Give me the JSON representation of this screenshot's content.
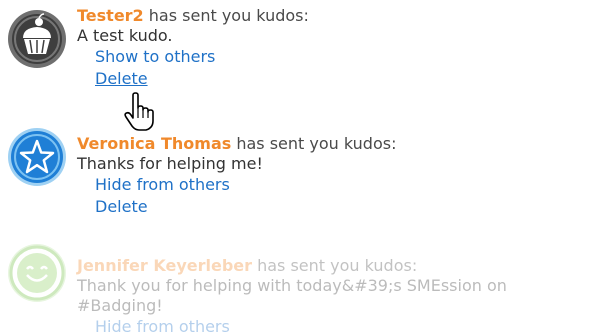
{
  "kudos": [
    {
      "sender": "Tester2",
      "suffix": " has sent you kudos:",
      "message": "A test kudo.",
      "actions": [
        "Show to others",
        "Delete"
      ],
      "badge": "cupcake-icon"
    },
    {
      "sender": "Veronica Thomas",
      "suffix": " has sent you kudos:",
      "message": "Thanks for helping me!",
      "actions": [
        "Hide from others",
        "Delete"
      ],
      "badge": "star-icon"
    },
    {
      "sender": "Jennifer Keyerleber",
      "suffix": " has sent you kudos:",
      "message_line1": "Thank you for helping with today&#39;s SMEssion on",
      "message_line2": "#Badging!",
      "actions": [
        "Hide from others"
      ],
      "badge": "smiley-icon"
    }
  ],
  "colors": {
    "sender": "#f0892b",
    "link": "#1f71c7",
    "text": "#333333"
  },
  "cursor": "hand-pointer-icon"
}
